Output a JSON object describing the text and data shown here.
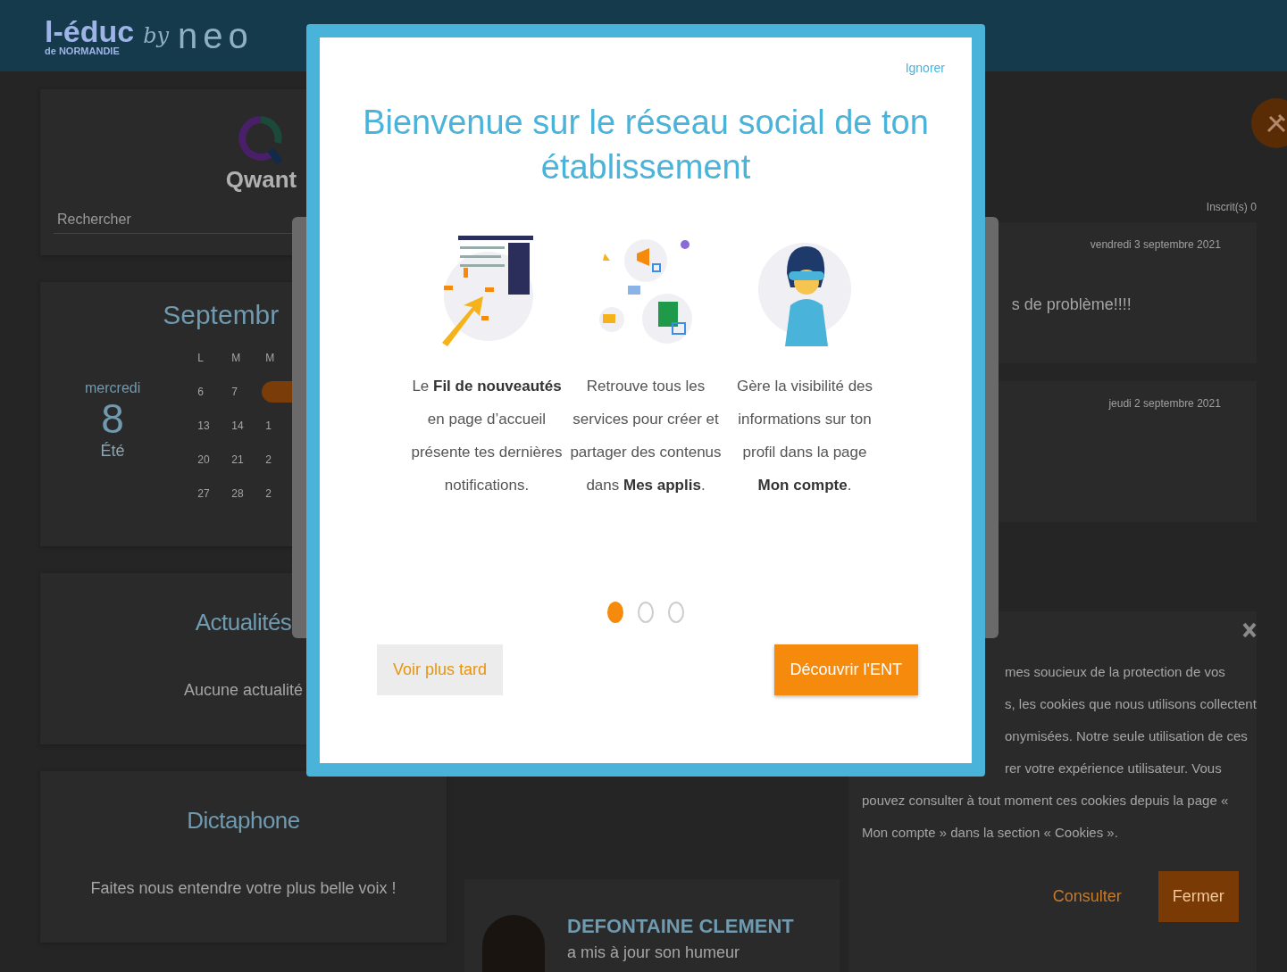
{
  "header": {
    "logo": {
      "name": "l-éduc",
      "region": "de NORMANDIE",
      "by": "by",
      "brand": "neo"
    }
  },
  "search_widget": {
    "brand": "Qwant",
    "placeholder": "Rechercher"
  },
  "calendar": {
    "month": "Septembr",
    "weekday": "mercredi",
    "day": "8",
    "season": "Été",
    "weekdays": [
      "L",
      "M",
      "M"
    ],
    "weeks": [
      [
        {
          "text": "6",
          "selected": false
        },
        {
          "text": "7",
          "selected": false
        },
        {
          "selected": true
        }
      ],
      [
        {
          "text": "13",
          "selected": false
        },
        {
          "text": "14",
          "selected": false
        },
        {
          "text": "1",
          "selected": false
        }
      ],
      [
        {
          "text": "20",
          "selected": false
        },
        {
          "text": "21",
          "selected": false
        },
        {
          "text": "2",
          "selected": false
        }
      ],
      [
        {
          "text": "27",
          "selected": false
        },
        {
          "text": "28",
          "selected": false
        },
        {
          "text": "2",
          "selected": false
        }
      ]
    ]
  },
  "news": {
    "title": "Actualités",
    "empty": "Aucune actualité"
  },
  "dictaphone": {
    "title": "Dictaphone",
    "text": "Faites nous entendre votre plus belle voix !"
  },
  "feed": {
    "subscribers": "Inscrit(s) 0",
    "posts": [
      {
        "date": "vendredi 3 septembre 2021",
        "text": "s de problème!!!!"
      },
      {
        "date": "jeudi 2 septembre 2021"
      }
    ]
  },
  "activity": {
    "author": "DEFONTAINE CLEMENT",
    "action": "a mis à jour son humeur"
  },
  "cookie_notice": {
    "lines": [
      {
        "kind": "clipped",
        "text": "mes soucieux de la protection de vos"
      },
      {
        "kind": "clipped",
        "text": "s, les cookies que nous utilisons collectent"
      },
      {
        "kind": "clipped",
        "text": "onymisées. Notre seule utilisation de ces"
      },
      {
        "kind": "clipped",
        "text": "rer votre expérience utilisateur. Vous"
      },
      {
        "kind": "full",
        "text": "pouvez consulter à tout moment ces cookies depuis la page «"
      },
      {
        "kind": "full",
        "text": "Mon compte » dans la section « Cookies »."
      }
    ],
    "buttons": [
      {
        "label": "Consulter",
        "kind": "text"
      },
      {
        "label": "Fermer",
        "kind": "filled"
      }
    ]
  },
  "welcome_dialog": {
    "skip": "Ignorer",
    "title": "Bienvenue sur le réseau social de ton établissement",
    "features": [
      {
        "kind": "feed",
        "text": "Le **Fil de nouveautés** en page d’accueil présente tes dernières notifications."
      },
      {
        "kind": "apps",
        "text": "Retrouve tous les services pour créer et partager des contenus dans **Mes applis**."
      },
      {
        "kind": "account",
        "text": "Gère la visibilité des informations sur ton profil dans la page **Mon compte**."
      }
    ],
    "pager": [
      {
        "selected": true
      },
      {
        "selected": false
      },
      {
        "selected": false
      }
    ],
    "later": "Voir plus tard",
    "discover": "Découvrir l'ENT"
  }
}
